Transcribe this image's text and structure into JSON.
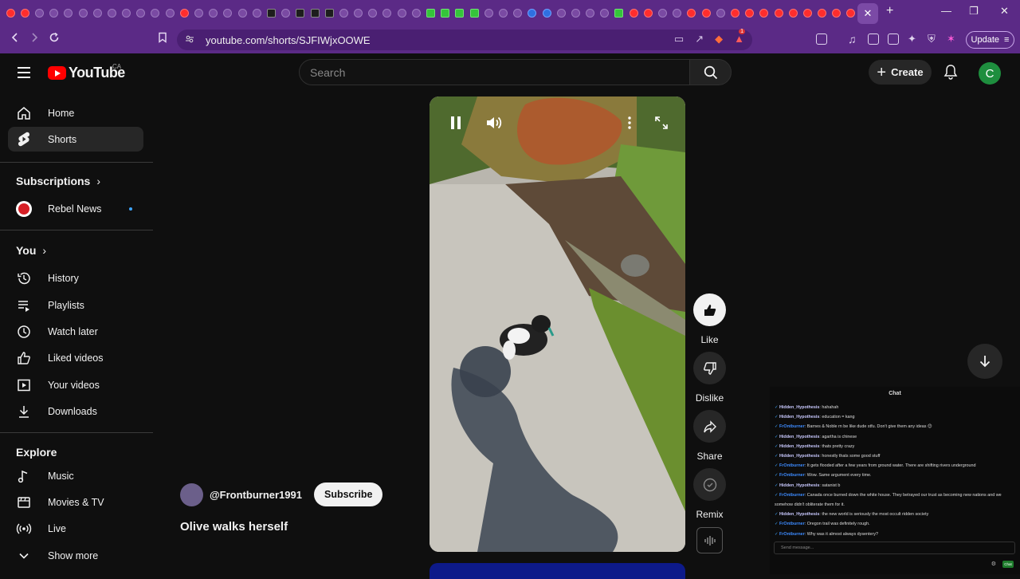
{
  "browser": {
    "tab_favicon_kinds": [
      "red",
      "red",
      "purple",
      "purple",
      "purple",
      "purple",
      "purple",
      "purple",
      "purple",
      "purple",
      "purple",
      "purple",
      "red",
      "purple",
      "purple",
      "purple",
      "purple",
      "purple",
      "x",
      "purple",
      "x",
      "x",
      "x",
      "purple",
      "purple",
      "purple",
      "purple",
      "purple",
      "purple",
      "green",
      "green",
      "green",
      "green",
      "purple",
      "purple",
      "purple",
      "blue",
      "blue",
      "purple",
      "purple",
      "purple",
      "purple",
      "green",
      "red",
      "red",
      "purple",
      "purple",
      "red",
      "red",
      "purple",
      "red",
      "red",
      "red",
      "red",
      "red",
      "red",
      "red",
      "red",
      "red"
    ],
    "close_tab_glyph": "✕",
    "new_tab_glyph": "+",
    "url": "youtube.com/shorts/SJFIWjxOOWE",
    "update_label": "Update",
    "extension_badge": "1"
  },
  "header": {
    "logo_text": "YouTube",
    "country_code": "CA",
    "search_placeholder": "Search",
    "create_label": "Create",
    "avatar_initial": "C"
  },
  "sidebar": {
    "home": "Home",
    "shorts": "Shorts",
    "subscriptions_heading": "Subscriptions",
    "subscription_channel": "Rebel News",
    "you_heading": "You",
    "history": "History",
    "playlists": "Playlists",
    "watch_later": "Watch later",
    "liked_videos": "Liked videos",
    "your_videos": "Your videos",
    "downloads": "Downloads",
    "explore_heading": "Explore",
    "music": "Music",
    "movies_tv": "Movies & TV",
    "live": "Live",
    "show_more": "Show more"
  },
  "short": {
    "channel_handle": "@Frontburner1991",
    "subscribe_label": "Subscribe",
    "title": "Olive walks herself",
    "actions": {
      "like": "Like",
      "dislike": "Dislike",
      "share": "Share",
      "remix": "Remix"
    }
  },
  "chat": {
    "title": "Chat",
    "input_placeholder": "Send message...",
    "send_label": "Chat",
    "messages": [
      {
        "user": "Hidden_Hypothesis",
        "text": ": hahahah",
        "kind": "a"
      },
      {
        "user": "Hidden_Hypothesis",
        "text": ": education = kang",
        "kind": "a"
      },
      {
        "user": "FrOntburner",
        "text": ": Barnes & Noble rn be like dude stfu. Don't give them any ideas 😊",
        "kind": "b"
      },
      {
        "user": "Hidden_Hypothesis",
        "text": ": agartha is chinese",
        "kind": "a"
      },
      {
        "user": "Hidden_Hypothesis",
        "text": ": thats pretty crazy",
        "kind": "a"
      },
      {
        "user": "Hidden_Hypothesis",
        "text": ": honestly thats some good stuff",
        "kind": "a"
      },
      {
        "user": "FrOntburner",
        "text": ": It gets flooded after a few years from ground water. There are shifting rivers underground",
        "kind": "b"
      },
      {
        "user": "FrOntburner",
        "text": ": Wow. Same argument every time.",
        "kind": "b"
      },
      {
        "user": "Hidden_Hypothesis",
        "text": ": satanist b",
        "kind": "a"
      },
      {
        "user": "FrOntburner",
        "text": ": Canada once burned down the white house. They betrayed our trust as becoming new nations and we somehow didn't obliterate them for it.",
        "kind": "b"
      },
      {
        "user": "Hidden_Hypothesis",
        "text": ": the new world is seriously the most occult ridden society",
        "kind": "a"
      },
      {
        "user": "FrOntburner",
        "text": ": Oregon trail was definitely rough.",
        "kind": "b"
      },
      {
        "user": "FrOntburner",
        "text": ": Why was it almost always dysentery?",
        "kind": "b"
      }
    ]
  }
}
